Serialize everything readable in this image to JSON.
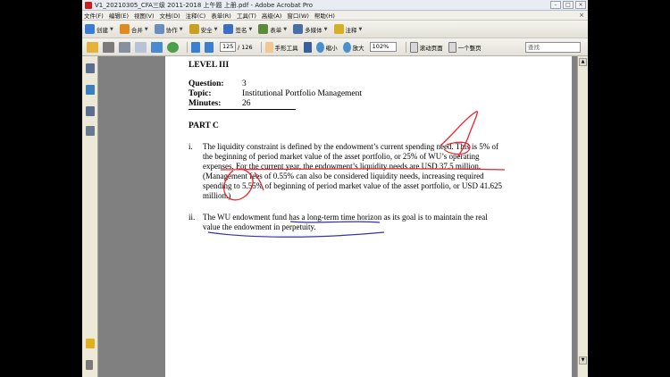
{
  "window": {
    "title": "V1_20210305_CFA三级 2011-2018 上午题 上册.pdf - Adobe Acrobat Pro",
    "buttons": [
      "–",
      "□",
      "×"
    ]
  },
  "menu": {
    "items": [
      "文件(F)",
      "编辑(E)",
      "视图(V)",
      "文档(D)",
      "注释(C)",
      "表单(R)",
      "工具(T)",
      "高级(A)",
      "窗口(W)",
      "帮助(H)"
    ]
  },
  "toolbar": {
    "items": [
      {
        "label": "创建",
        "color": "#3a7bd5"
      },
      {
        "label": "合并",
        "color": "#e08a1e"
      },
      {
        "label": "协作",
        "color": "#6a8fbf"
      },
      {
        "label": "安全",
        "color": "#c9a020"
      },
      {
        "label": "签名",
        "color": "#3a6fc4"
      },
      {
        "label": "表单",
        "color": "#5a8a3a"
      },
      {
        "label": "多媒体",
        "color": "#4a6fa5"
      },
      {
        "label": "注释",
        "color": "#d6b020"
      }
    ]
  },
  "nav": {
    "page_current": "125",
    "page_total": "/ 126",
    "hand_tool": "手形工具",
    "zoom_out": "缩小",
    "zoom_in": "放大",
    "zoom_level": "102%",
    "scroll_mode": "滚动页面",
    "one_page": "一个整页",
    "search_placeholder": "查找"
  },
  "document": {
    "level": "LEVEL III",
    "question_label": "Question:",
    "question_value": "3",
    "topic_label": "Topic:",
    "topic_value": "Institutional Portfolio Management",
    "minutes_label": "Minutes:",
    "minutes_value": "26",
    "part": "PART C",
    "item1_num": "i.",
    "item1_lines": [
      "The liquidity constraint is defined by the endowment’s current spending need. This is 5% of",
      "the beginning of period market value of the asset portfolio, or 25% of WU’s operating",
      "expenses. For the current year, the endowment’s liquidity needs are USD 37.5 million.",
      "(Management fees of 0.55% can also be considered liquidity needs, increasing required",
      "spending to 5.55% of beginning of period market value of the asset portfolio, or USD 41.625",
      "million.)"
    ],
    "item2_num": "ii.",
    "item2_lines": [
      "The WU endowment fund has a long-term time horizon as its goal is to maintain the real",
      "value the endowment in perpetuity."
    ]
  },
  "colors": {
    "annotation": "#e8232a",
    "underline": "#3a2fa8"
  }
}
